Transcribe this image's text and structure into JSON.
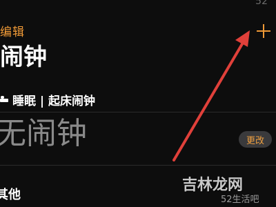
{
  "statusbar": {
    "time": "52"
  },
  "nav": {
    "edit_label": "编辑",
    "add_icon": "plus-icon"
  },
  "page": {
    "title": "闹钟"
  },
  "sleep_section": {
    "icon": "bed-icon",
    "label": "睡眠 | 起床闹钟"
  },
  "alarm": {
    "empty_text": "无闹钟",
    "change_button": "更改"
  },
  "other_section": {
    "title": "其他"
  },
  "annotation": {
    "arrow_color": "#e0403a"
  },
  "watermark": {
    "brand": "吉林龙网",
    "site": "52生活吧"
  },
  "colors": {
    "accent": "#f09a37",
    "background": "#0d0d0d"
  }
}
